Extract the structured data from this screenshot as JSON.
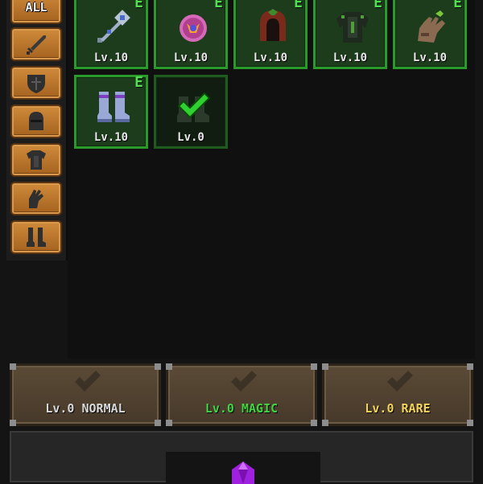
{
  "sidebar": {
    "categories": [
      {
        "label": "ALL",
        "icon": "all-label"
      },
      {
        "label": "",
        "icon": "sword-icon"
      },
      {
        "label": "",
        "icon": "shield-icon"
      },
      {
        "label": "",
        "icon": "helmet-icon"
      },
      {
        "label": "",
        "icon": "armor-icon"
      },
      {
        "label": "",
        "icon": "glove-icon"
      },
      {
        "label": "",
        "icon": "boots-icon"
      }
    ]
  },
  "inventory": {
    "items": [
      {
        "name": "mace",
        "level": "Lv.10",
        "equipped_badge": "E"
      },
      {
        "name": "amulet",
        "level": "Lv.10",
        "equipped_badge": "E"
      },
      {
        "name": "hood",
        "level": "Lv.10",
        "equipped_badge": "E"
      },
      {
        "name": "chest-armor",
        "level": "Lv.10",
        "equipped_badge": "E"
      },
      {
        "name": "gauntlet",
        "level": "Lv.10",
        "equipped_badge": "E"
      },
      {
        "name": "boots",
        "level": "Lv.10",
        "equipped_badge": "E"
      },
      {
        "name": "dark-boots",
        "level": "Lv.0",
        "equipped_badge": ""
      }
    ]
  },
  "filters": [
    {
      "label": "Lv.0 NORMAL",
      "color": "#d8d8d8"
    },
    {
      "label": "Lv.0 MAGIC",
      "color": "#42d442"
    },
    {
      "label": "Lv.0 RARE",
      "color": "#f2d45c"
    }
  ],
  "colors": {
    "equipped_border": "#2a9a2a",
    "check_green": "#2fd02f",
    "gem_purple": "#a020e0",
    "category_orange": "#c27a2e"
  }
}
